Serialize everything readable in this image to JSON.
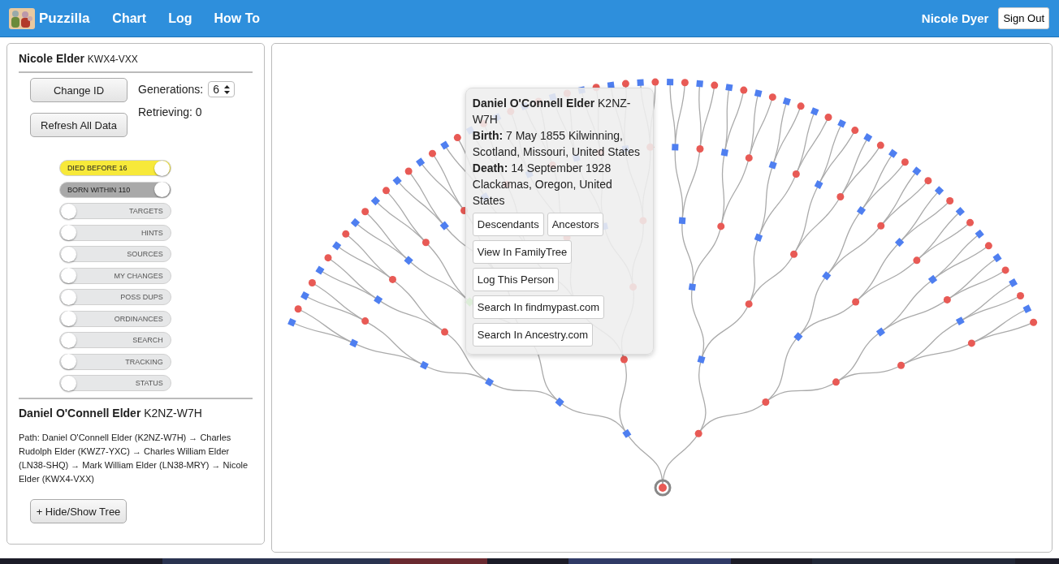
{
  "navbar": {
    "brand": "Puzzilla",
    "links": [
      "Chart",
      "Log",
      "How To"
    ],
    "user": "Nicole Dyer",
    "sign_out": "Sign Out"
  },
  "sidebar": {
    "person": {
      "name": "Nicole Elder",
      "id": "KWX4-VXX"
    },
    "buttons": [
      "Change ID",
      "Refresh All Data"
    ],
    "generations": {
      "label": "Generations:",
      "value": "6"
    },
    "retrieving": "Retrieving: 0",
    "toggles": [
      {
        "label": "DIED BEFORE 16",
        "on": true,
        "color": "#f7e93a"
      },
      {
        "label": "BORN WITHIN 110",
        "on": true,
        "color": "#a9a9a9"
      },
      {
        "label": "TARGETS",
        "on": false,
        "color": "#e6e7e8"
      },
      {
        "label": "HINTS",
        "on": false,
        "color": "#e6e7e8"
      },
      {
        "label": "SOURCES",
        "on": false,
        "color": "#e6e7e8"
      },
      {
        "label": "MY CHANGES",
        "on": false,
        "color": "#e6e7e8"
      },
      {
        "label": "POSS DUPS",
        "on": false,
        "color": "#e6e7e8"
      },
      {
        "label": "ORDINANCES",
        "on": false,
        "color": "#e6e7e8"
      },
      {
        "label": "SEARCH",
        "on": false,
        "color": "#e6e7e8"
      },
      {
        "label": "TRACKING",
        "on": false,
        "color": "#e6e7e8"
      },
      {
        "label": "STATUS",
        "on": false,
        "color": "#e6e7e8"
      }
    ],
    "selected": {
      "name": "Daniel O'Connell Elder",
      "id": "K2NZ-W7H",
      "path": "Path: Daniel O'Connell Elder (K2NZ-W7H) → Charles Rudolph Elder (KWZ7-YXC) → Charles William Elder (LN38-SHQ) → Mark William Elder (LN38-MRY) → Nicole Elder (KWX4-VXX)"
    },
    "tree_button": "+ Hide/Show Tree"
  },
  "popup": {
    "heading": "**Daniel O'Connell Elder** K2NZ-W7H",
    "birth": "**Birth:** 7 May 1855 Kilwinning, Scotland, Missouri, United States",
    "death": "**Death:** 14 September 1928 Clackamas, Oregon, United States",
    "buttons": [
      [
        "Descendants",
        "Ancestors"
      ],
      [
        "View In FamilyTree"
      ],
      [
        "Log This Person"
      ],
      [
        "Search In findmypast.com"
      ],
      [
        "Search In Ancestry.com"
      ]
    ]
  }
}
